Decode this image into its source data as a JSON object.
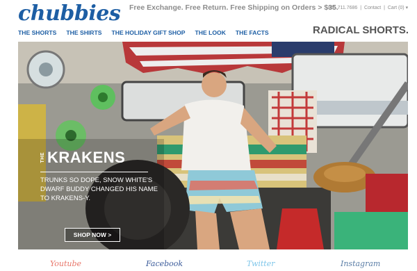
{
  "header": {
    "logo": "chubbies",
    "promo": "Free Exchange. Free Return. Free Shipping on Orders > $35.",
    "phone": "855.711.7686",
    "contact": "Contact",
    "cart": "Cart (0)"
  },
  "nav": {
    "items": [
      {
        "label": "THE SHORTS"
      },
      {
        "label": "THE SHIRTS"
      },
      {
        "label": "THE HOLIDAY GIFT SHOP"
      },
      {
        "label": "THE LOOK"
      },
      {
        "label": "THE FACTS"
      }
    ],
    "tagline": "RADICAL SHORTS."
  },
  "hero": {
    "headline_prefix": "THE",
    "headline": "KRAKENS",
    "copy": "Trunks so dope, Snow White's dwarf buddy changed his name to Krakens-y.",
    "cta": "SHOP NOW >"
  },
  "social": {
    "youtube": "Youtube",
    "facebook": "Facebook",
    "twitter": "Twitter",
    "instagram": "Instagram"
  },
  "colors": {
    "brand": "#1d5ea4",
    "promo_text": "#8c8c8c",
    "youtube": "#e8766a",
    "facebook": "#3b5b9a",
    "twitter": "#7ec6ea",
    "instagram": "#5a7da6"
  },
  "icons": [
    "cart-chevron-icon"
  ]
}
